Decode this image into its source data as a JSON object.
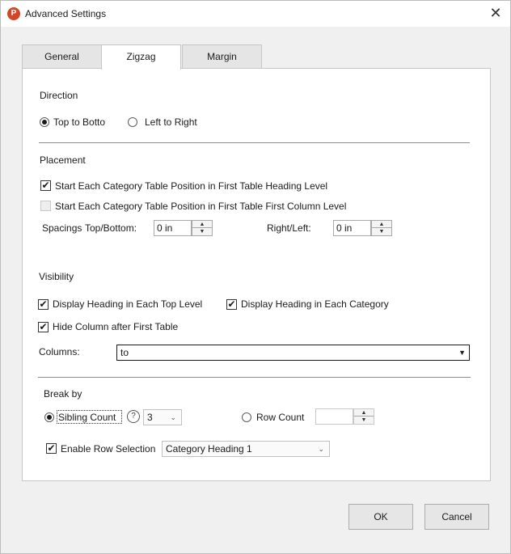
{
  "window": {
    "title": "Advanced Settings",
    "app_icon_letter": "P",
    "close_label": "✕"
  },
  "tabs": [
    {
      "label": "General",
      "active": false
    },
    {
      "label": "Zigzag",
      "active": true
    },
    {
      "label": "Margin",
      "active": false
    }
  ],
  "direction": {
    "label": "Direction",
    "options": [
      {
        "label": "Top to Botto",
        "selected": true
      },
      {
        "label": "Left to Right",
        "selected": false
      }
    ]
  },
  "placement": {
    "label": "Placement",
    "checks": [
      {
        "label": "Start Each Category Table Position in First Table Heading Level",
        "checked": true,
        "enabled": true
      },
      {
        "label": "Start Each Category Table Position in First Table First Column Level",
        "checked": false,
        "enabled": false
      }
    ],
    "spacings_label": "Spacings",
    "top_bottom_label": "Top/Bottom:",
    "top_bottom_value": "0 in",
    "right_left_label": "Right/Left:",
    "right_left_value": "0 in"
  },
  "visibility": {
    "label": "Visibility",
    "display_heading_top": {
      "label": "Display Heading in Each Top Level",
      "checked": true
    },
    "display_heading_category": {
      "label": "Display Heading in Each Category",
      "checked": true
    },
    "hide_column": {
      "label": "Hide Column after First Table",
      "checked": true
    },
    "columns_label": "Columns:",
    "columns_value": "to"
  },
  "break_by": {
    "label": "Break by",
    "sibling_count_label": "Sibling Count",
    "sibling_selected": true,
    "help_label": "?",
    "sibling_value": "3",
    "row_count_label": "Row Count",
    "row_selected": false,
    "row_count_value": "",
    "enable_row_selection": {
      "label": "Enable Row Selection",
      "checked": true
    },
    "row_selection_value": "Category Heading 1"
  },
  "buttons": {
    "ok": "OK",
    "cancel": "Cancel"
  },
  "glyphs": {
    "check": "✔",
    "spin_up": "▲",
    "spin_down": "▼",
    "dropdown": "▼",
    "combo": "⌄"
  }
}
